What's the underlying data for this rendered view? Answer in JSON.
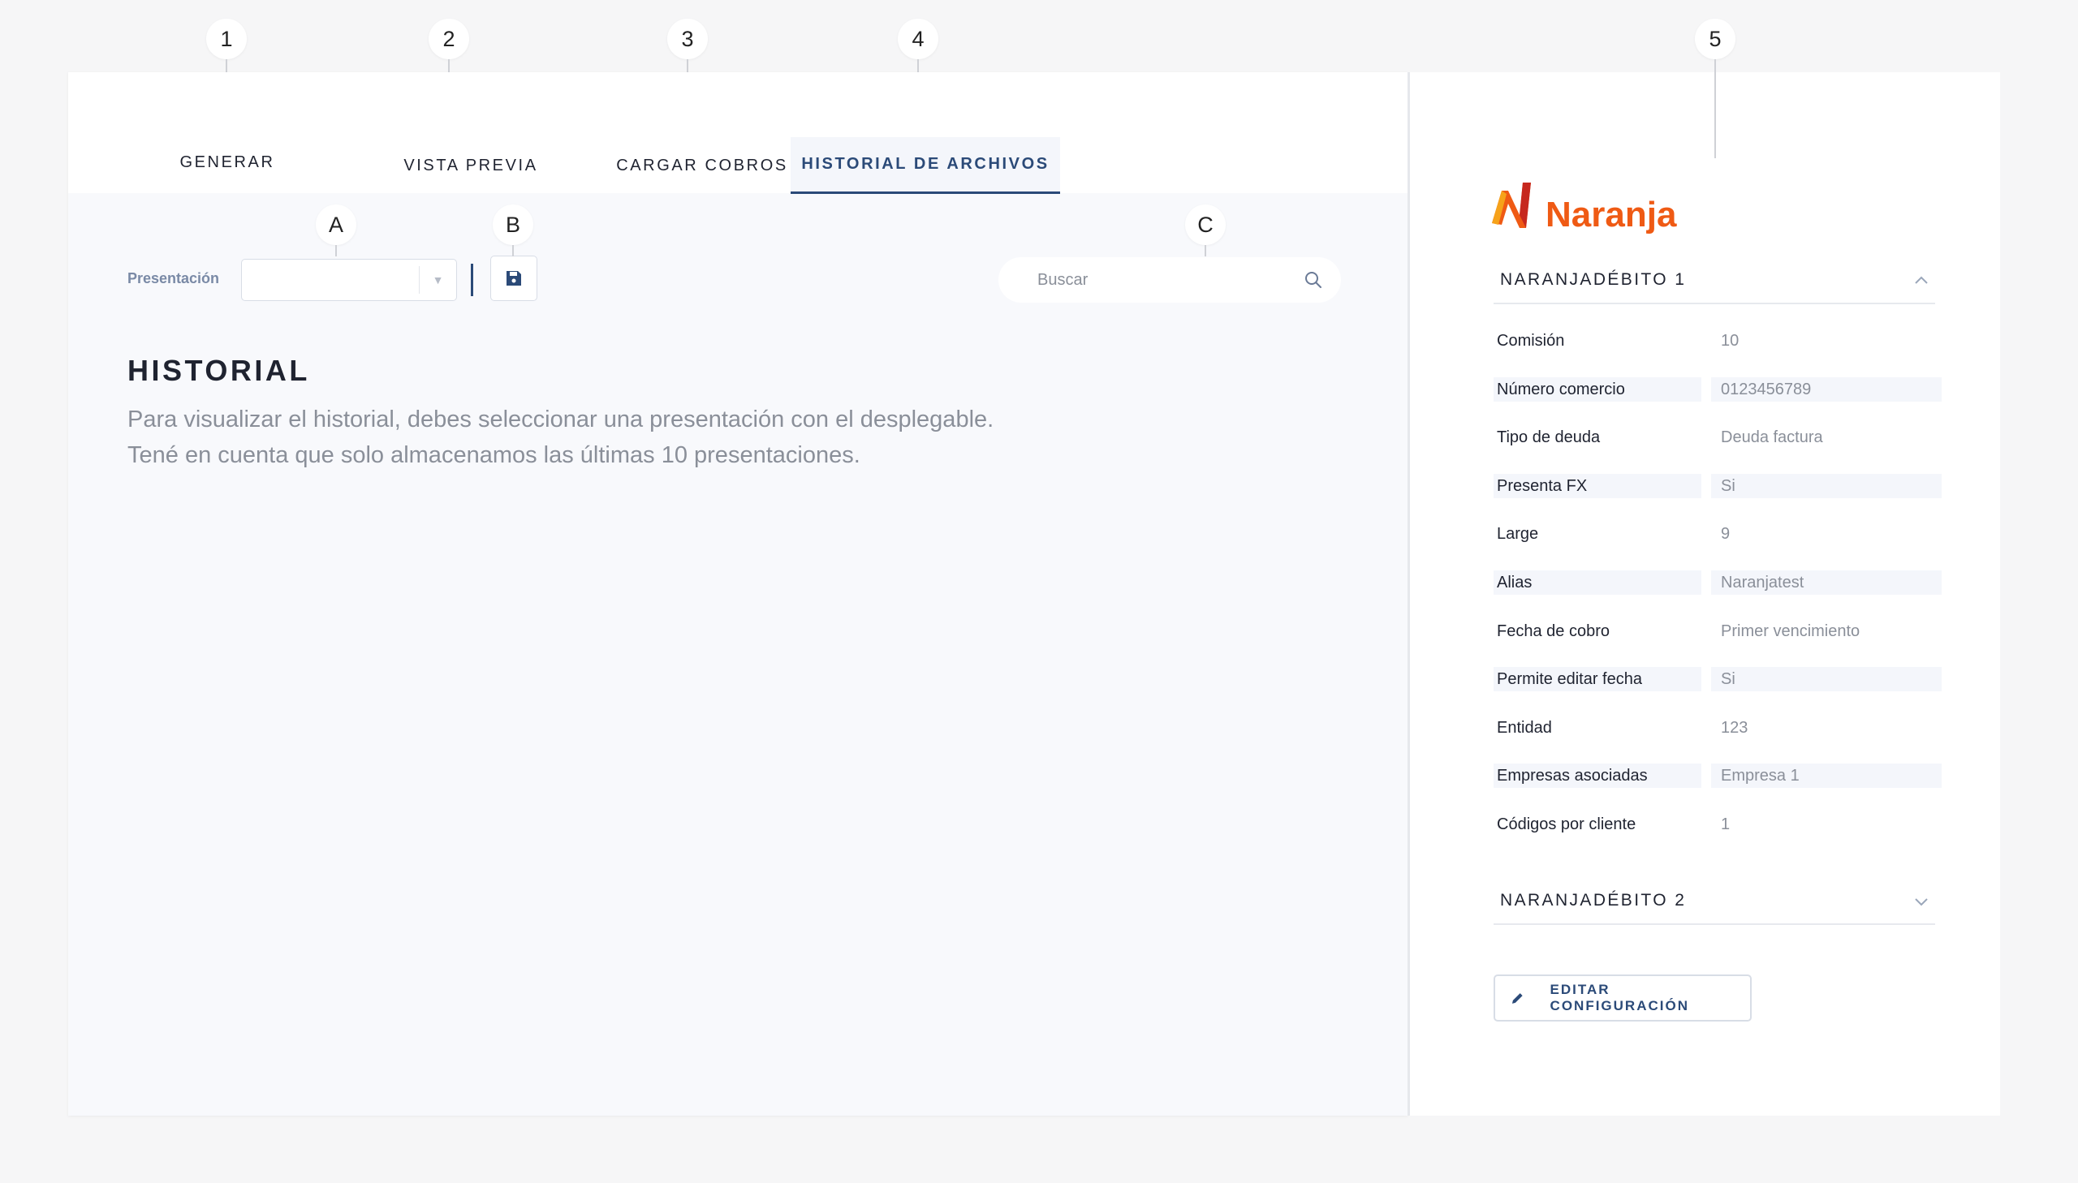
{
  "callouts": [
    "1",
    "2",
    "3",
    "4",
    "5",
    "A",
    "B",
    "C"
  ],
  "tabs": [
    {
      "label": "GENERAR"
    },
    {
      "label": "VISTA PREVIA"
    },
    {
      "label": "CARGAR COBROS"
    },
    {
      "label": "HISTORIAL DE ARCHIVOS",
      "active": true
    }
  ],
  "toolbar": {
    "presentacion_label": "Presentación",
    "presentacion_value": "",
    "search_placeholder": "Buscar"
  },
  "historial": {
    "title": "HISTORIAL",
    "line1": "Para visualizar el historial, debes seleccionar una presentación con el desplegable.",
    "line2": "Tené en cuenta que solo almacenamos las últimas 10 presentaciones."
  },
  "panel": {
    "logo_text": "Naranja",
    "section1": {
      "title": "NARANJADÉBITO 1",
      "expanded": true,
      "rows": [
        {
          "key": "Comisión",
          "value": "10"
        },
        {
          "key": "Número comercio",
          "value": "0123456789"
        },
        {
          "key": "Tipo de deuda",
          "value": "Deuda factura"
        },
        {
          "key": "Presenta FX",
          "value": "Si"
        },
        {
          "key": "Large",
          "value": "9"
        },
        {
          "key": "Alias",
          "value": "Naranjatest"
        },
        {
          "key": "Fecha de cobro",
          "value": "Primer vencimiento"
        },
        {
          "key": "Permite editar fecha",
          "value": "Si"
        },
        {
          "key": "Entidad",
          "value": "123"
        },
        {
          "key": "Empresas asociadas",
          "value": "Empresa 1"
        },
        {
          "key": "Códigos por cliente",
          "value": "1"
        }
      ]
    },
    "section2": {
      "title": "NARANJADÉBITO 2",
      "expanded": false
    },
    "edit_button": "EDITAR CONFIGURACIÓN"
  },
  "colors": {
    "accent": "#2b4a78",
    "brand_orange": "#ef5a14",
    "muted_text": "#8a8f99",
    "row_shade": "#f4f6fb"
  },
  "icons": [
    "save-icon",
    "search-icon",
    "chevron-up-icon",
    "chevron-down-icon",
    "pencil-icon",
    "dropdown-caret-icon"
  ]
}
